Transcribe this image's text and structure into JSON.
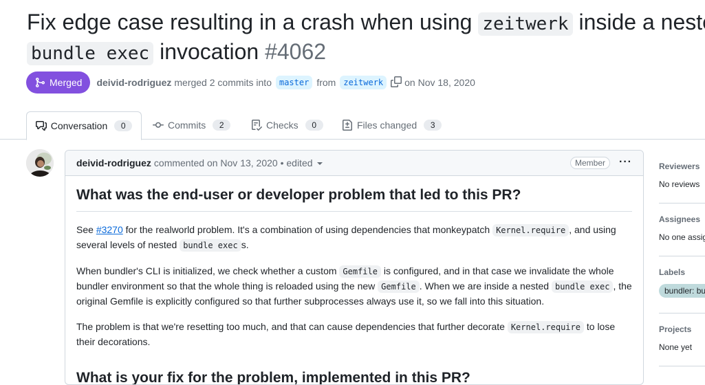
{
  "pr": {
    "title_part1": "Fix edge case resulting in a crash when using ",
    "title_code1": "zeitwerk",
    "title_part2": " inside a nested",
    "title_code2": "bundle exec",
    "title_part3": " invocation ",
    "number": "#4062",
    "state": "Merged",
    "author": "deivid-rodriguez",
    "merged_text": "merged 2 commits into",
    "base_branch": "master",
    "from_text": "from",
    "head_branch": "zeitwerk",
    "date_text": "on Nov 18, 2020"
  },
  "tabs": [
    {
      "label": "Conversation",
      "count": "0",
      "icon": "comment-discussion-icon"
    },
    {
      "label": "Commits",
      "count": "2",
      "icon": "git-commit-icon"
    },
    {
      "label": "Checks",
      "count": "0",
      "icon": "checklist-icon"
    },
    {
      "label": "Files changed",
      "count": "3",
      "icon": "file-diff-icon"
    }
  ],
  "comment": {
    "author": "deivid-rodriguez",
    "meta": "commented on Nov 13, 2020 • edited",
    "badge": "Member",
    "heading1": "What was the end-user or developer problem that led to this PR?",
    "p1_a": "See ",
    "p1_link": "#3270",
    "p1_b": " for the realworld problem. It's a combination of using dependencies that monkeypatch ",
    "p1_code1": "Kernel.require",
    "p1_c": ", and using several levels of nested ",
    "p1_code2": "bundle exec",
    "p1_d": "s.",
    "p2_a": "When bundler's CLI is initialized, we check whether a custom ",
    "p2_code1": "Gemfile",
    "p2_b": " is configured, and in that case we invalidate the whole bundler environment so that the whole thing is reloaded using the new ",
    "p2_code2": "Gemfile",
    "p2_c": ". When we are inside a nested ",
    "p2_code3": "bundle exec",
    "p2_d": ", the original Gemfile is explicitly configured so that further subprocesses always use it, so we fall into this situation.",
    "p3_a": "The problem is that we're resetting too much, and that can cause dependencies that further decorate ",
    "p3_code1": "Kernel.require",
    "p3_b": " to lose their decorations.",
    "heading2": "What is your fix for the problem, implemented in this PR?"
  },
  "sidebar": {
    "reviewers_h": "Reviewers",
    "reviewers_v": "No reviews",
    "assignees_h": "Assignees",
    "assignees_v": "No one assigned",
    "labels_h": "Labels",
    "label1": "bundler: bug fix",
    "projects_h": "Projects",
    "projects_v": "None yet"
  },
  "colors": {
    "merged": "#8250df",
    "link": "#0969da",
    "label": "#bfdadc"
  }
}
